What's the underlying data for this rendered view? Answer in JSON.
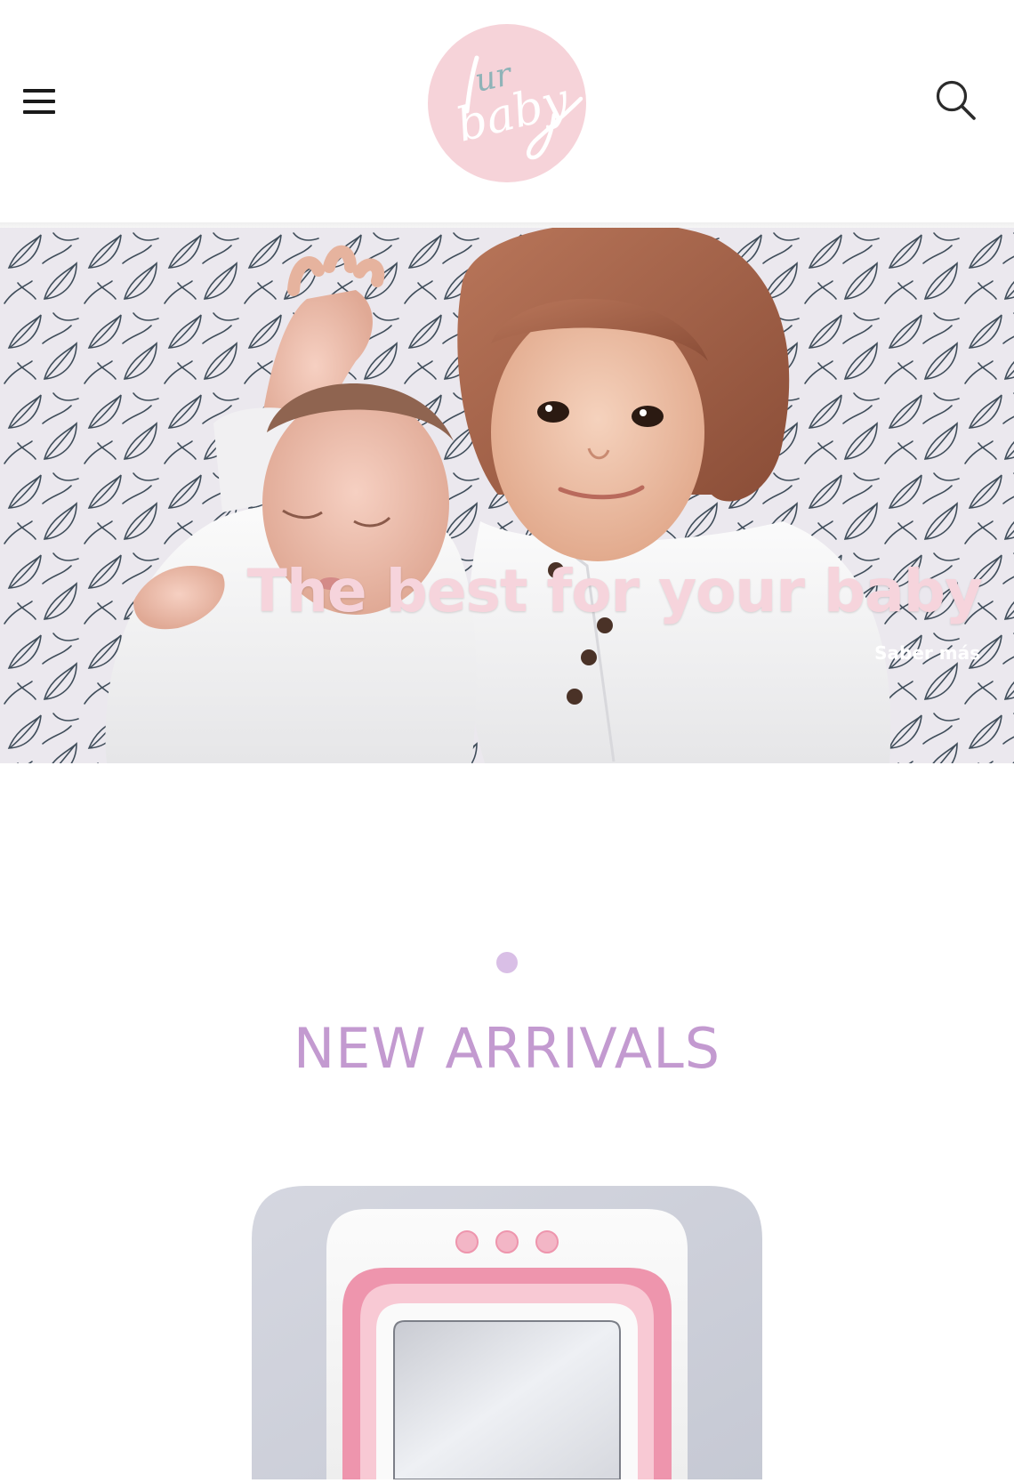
{
  "header": {
    "menu_icon": "hamburger-menu-icon",
    "search_icon": "search-icon",
    "logo": {
      "line1": "ur",
      "line2": "baby",
      "background": "#f6d3d9",
      "ink": "#ffffff",
      "accent": "#8fb3b8"
    }
  },
  "hero": {
    "title": "The best for your baby",
    "link": "Saber más",
    "title_color": "#f6d4dc"
  },
  "new_arrivals": {
    "title": "NEW ARRIVALS",
    "title_color": "#c39ad0",
    "dot_color": "#d9bfe6"
  },
  "colors": {
    "product_pink": "#ee95ad",
    "product_white": "#f4f3f3",
    "product_background": "#cfd2dc"
  }
}
